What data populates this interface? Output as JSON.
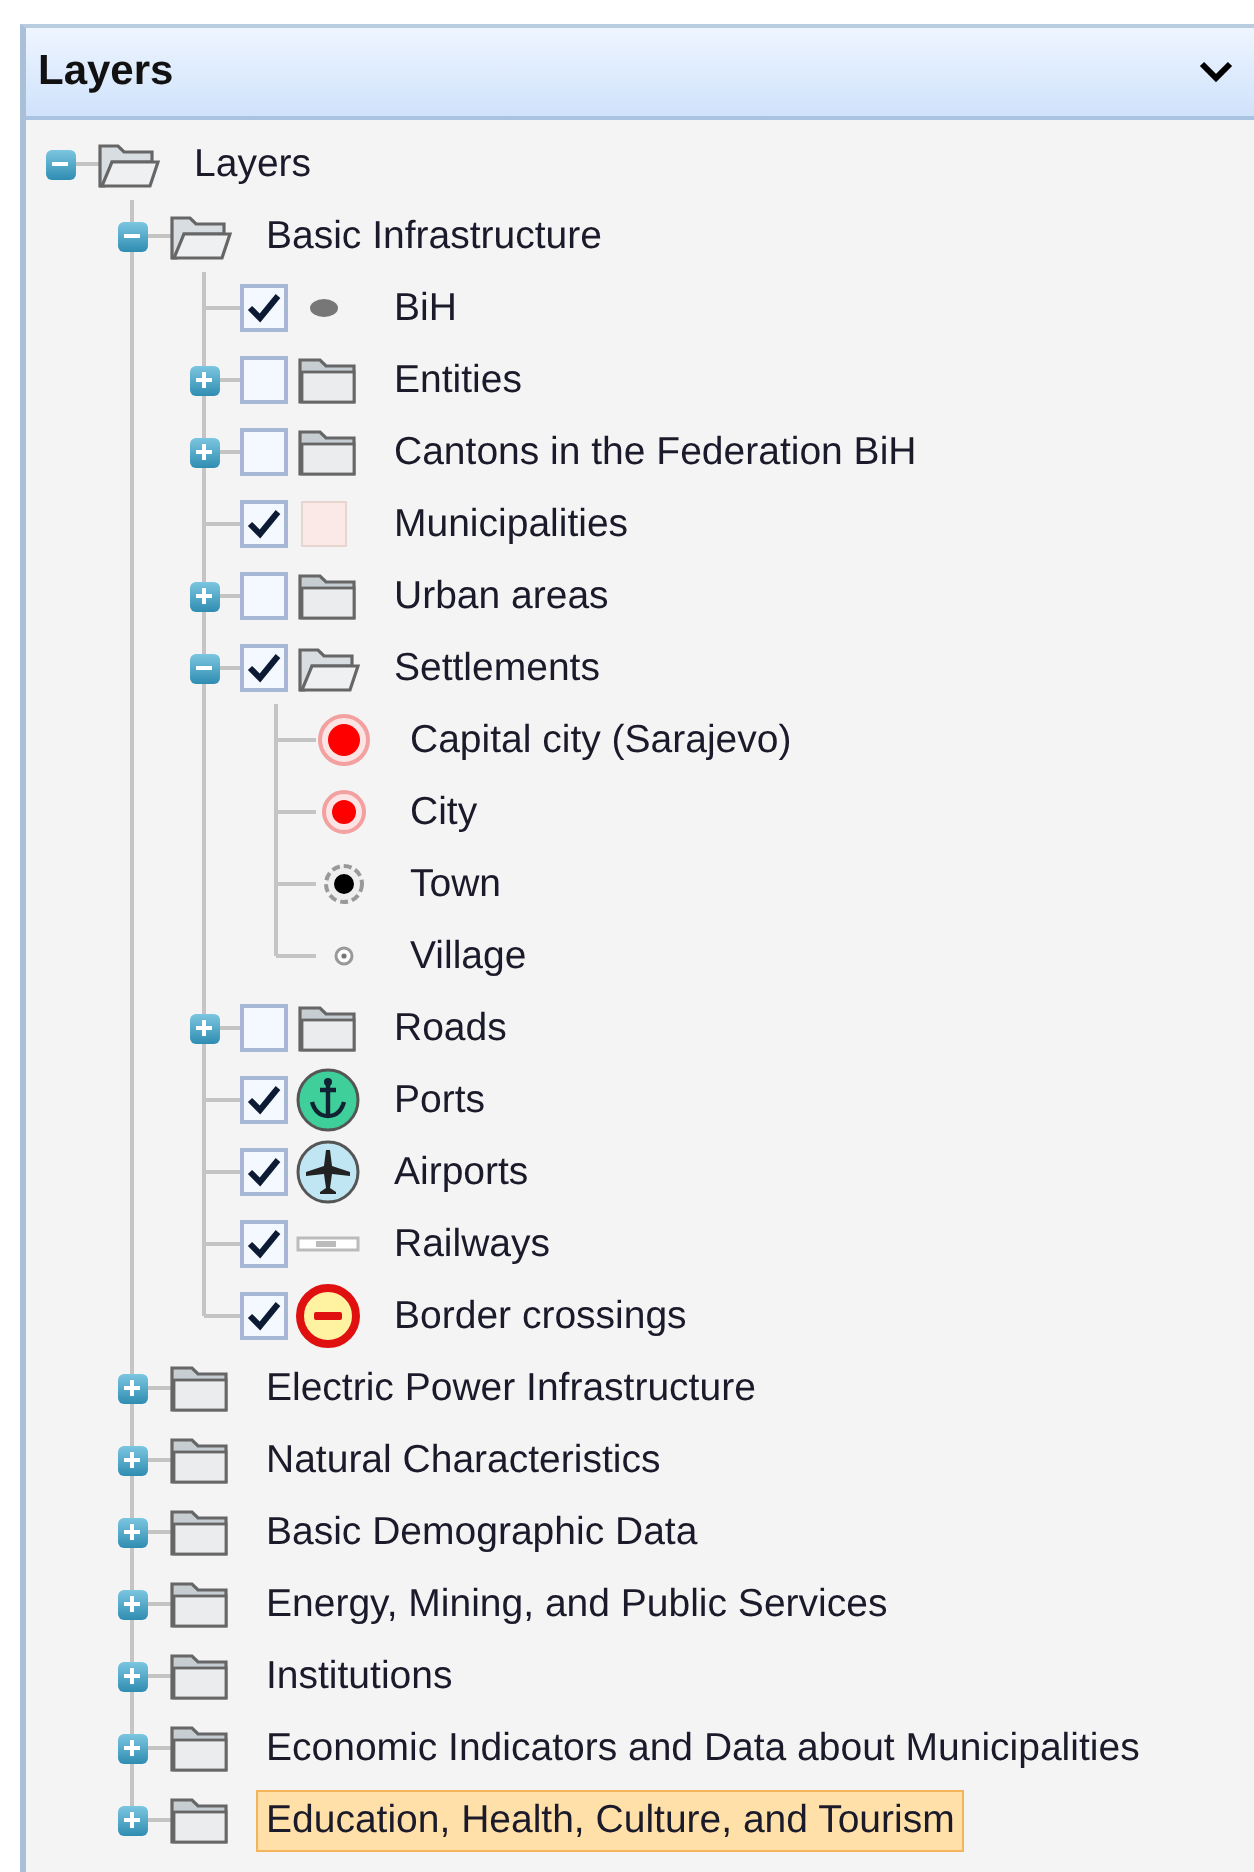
{
  "panel": {
    "title": "Layers"
  },
  "tree": [
    {
      "label": "Layers",
      "kind": "folder",
      "expanded": true,
      "selected": false,
      "children": [
        {
          "label": "Basic Infrastructure",
          "kind": "folder",
          "expanded": true,
          "selected": false,
          "children": [
            {
              "label": "BiH",
              "kind": "ellipse",
              "checked": true,
              "selected": false
            },
            {
              "label": "Entities",
              "kind": "folder",
              "expanded": false,
              "checked": false,
              "selected": false
            },
            {
              "label": "Cantons in the Federation BiH",
              "kind": "folder",
              "expanded": false,
              "checked": false,
              "selected": false
            },
            {
              "label": "Municipalities",
              "kind": "swatch",
              "checked": true,
              "selected": false
            },
            {
              "label": "Urban areas",
              "kind": "folder",
              "expanded": false,
              "checked": false,
              "selected": false
            },
            {
              "label": "Settlements",
              "kind": "folder",
              "expanded": true,
              "checked": true,
              "selected": false,
              "children": [
                {
                  "label": "Capital city (Sarajevo)",
                  "kind": "capital",
                  "selected": false
                },
                {
                  "label": "City",
                  "kind": "city",
                  "selected": false
                },
                {
                  "label": "Town",
                  "kind": "town",
                  "selected": false
                },
                {
                  "label": "Village",
                  "kind": "village",
                  "selected": false
                }
              ]
            },
            {
              "label": "Roads",
              "kind": "folder",
              "expanded": false,
              "checked": false,
              "selected": false
            },
            {
              "label": "Ports",
              "kind": "anchor",
              "checked": true,
              "selected": false
            },
            {
              "label": "Airports",
              "kind": "plane",
              "checked": true,
              "selected": false
            },
            {
              "label": "Railways",
              "kind": "rail",
              "checked": true,
              "selected": false
            },
            {
              "label": "Border crossings",
              "kind": "border",
              "checked": true,
              "selected": false
            }
          ]
        },
        {
          "label": "Electric Power Infrastructure",
          "kind": "folder",
          "expanded": false,
          "selected": false
        },
        {
          "label": "Natural Characteristics",
          "kind": "folder",
          "expanded": false,
          "selected": false
        },
        {
          "label": "Basic Demographic Data",
          "kind": "folder",
          "expanded": false,
          "selected": false
        },
        {
          "label": "Energy, Mining, and Public Services",
          "kind": "folder",
          "expanded": false,
          "selected": false
        },
        {
          "label": "Institutions",
          "kind": "folder",
          "expanded": false,
          "selected": false
        },
        {
          "label": "Economic Indicators and Data about Municipalities",
          "kind": "folder",
          "expanded": false,
          "selected": false
        },
        {
          "label": "Education, Health, Culture, and Tourism",
          "kind": "folder",
          "expanded": false,
          "selected": true
        }
      ]
    }
  ]
}
